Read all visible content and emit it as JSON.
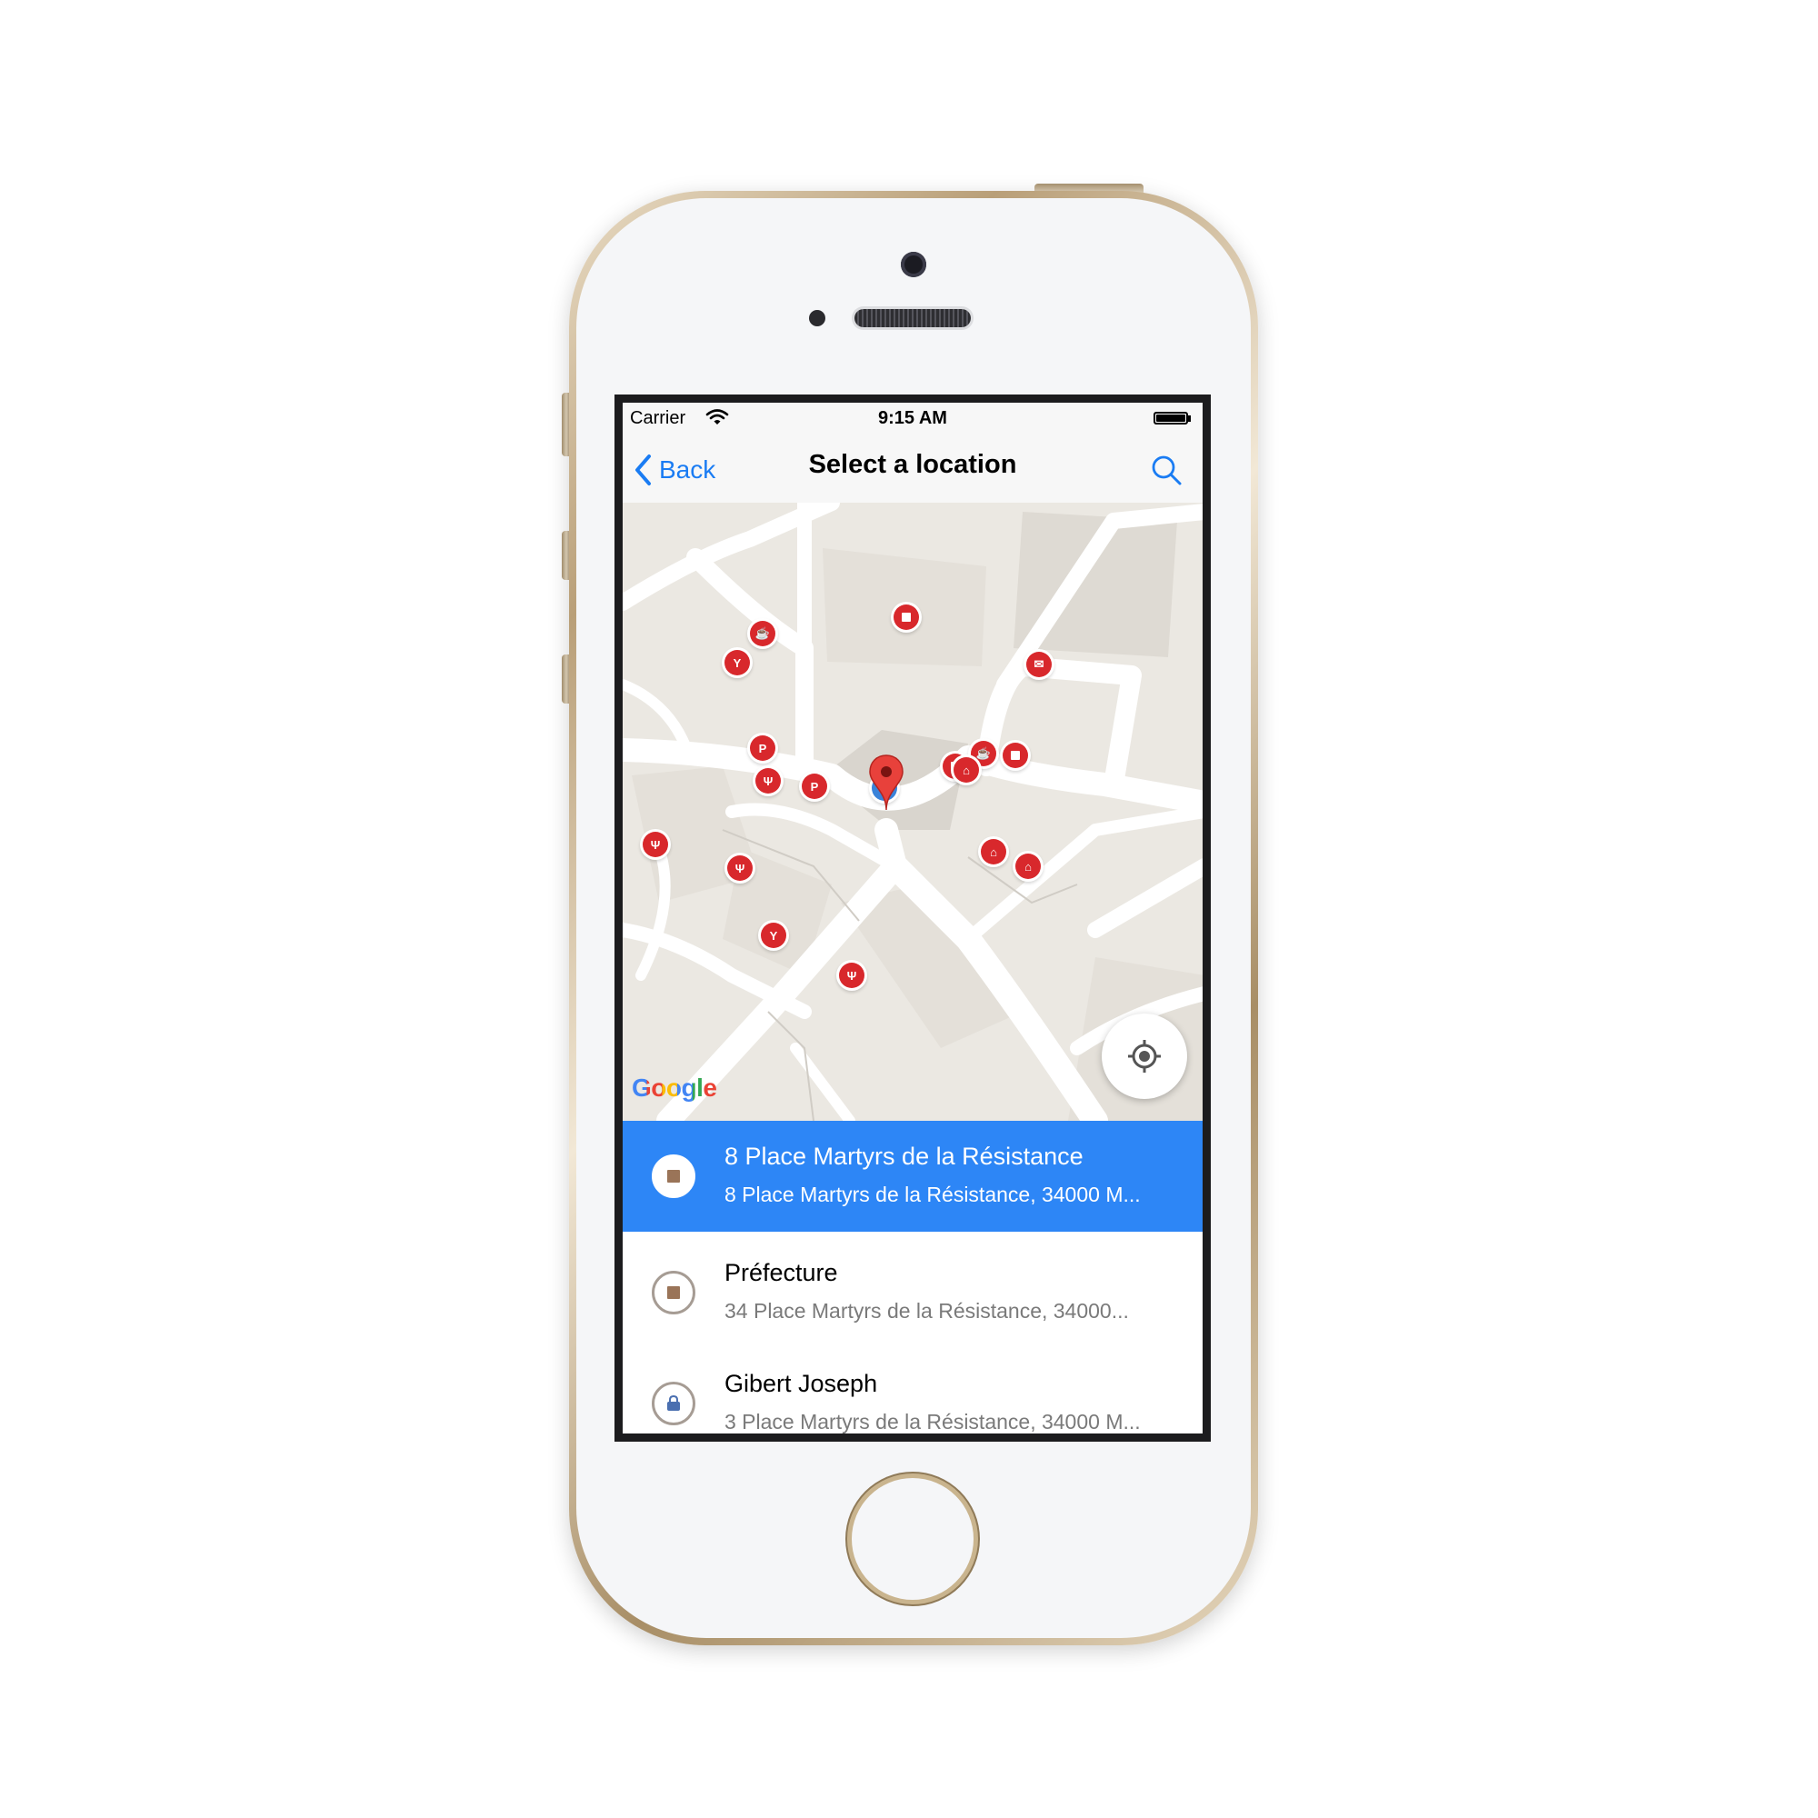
{
  "status_bar": {
    "carrier": "Carrier",
    "time": "9:15 AM"
  },
  "nav": {
    "back_label": "Back",
    "title": "Select a location",
    "accent_color": "#1a7cf3"
  },
  "map": {
    "provider_logo": "Google",
    "pin_color": "#e8413b",
    "poi_color": "#d8282c",
    "poi_types": [
      "store",
      "cafe",
      "bar",
      "mail",
      "park",
      "parking",
      "restaurant",
      "shopping"
    ],
    "parking_label": "P"
  },
  "results": [
    {
      "title": "8 Place Martyrs de la Résistance",
      "address": "8 Place Martyrs de la Résistance, 34000 M...",
      "icon": "store-icon",
      "selected": true
    },
    {
      "title": "Préfecture",
      "address": "34 Place Martyrs de la Résistance, 34000...",
      "icon": "store-icon",
      "selected": false
    },
    {
      "title": "Gibert Joseph",
      "address": "3 Place Martyrs de la Résistance, 34000 M...",
      "icon": "shopping-bag-icon",
      "selected": false
    }
  ],
  "colors": {
    "selected_row": "#2d86f6",
    "map_background": "#ebe8e2",
    "road": "#ffffff"
  }
}
